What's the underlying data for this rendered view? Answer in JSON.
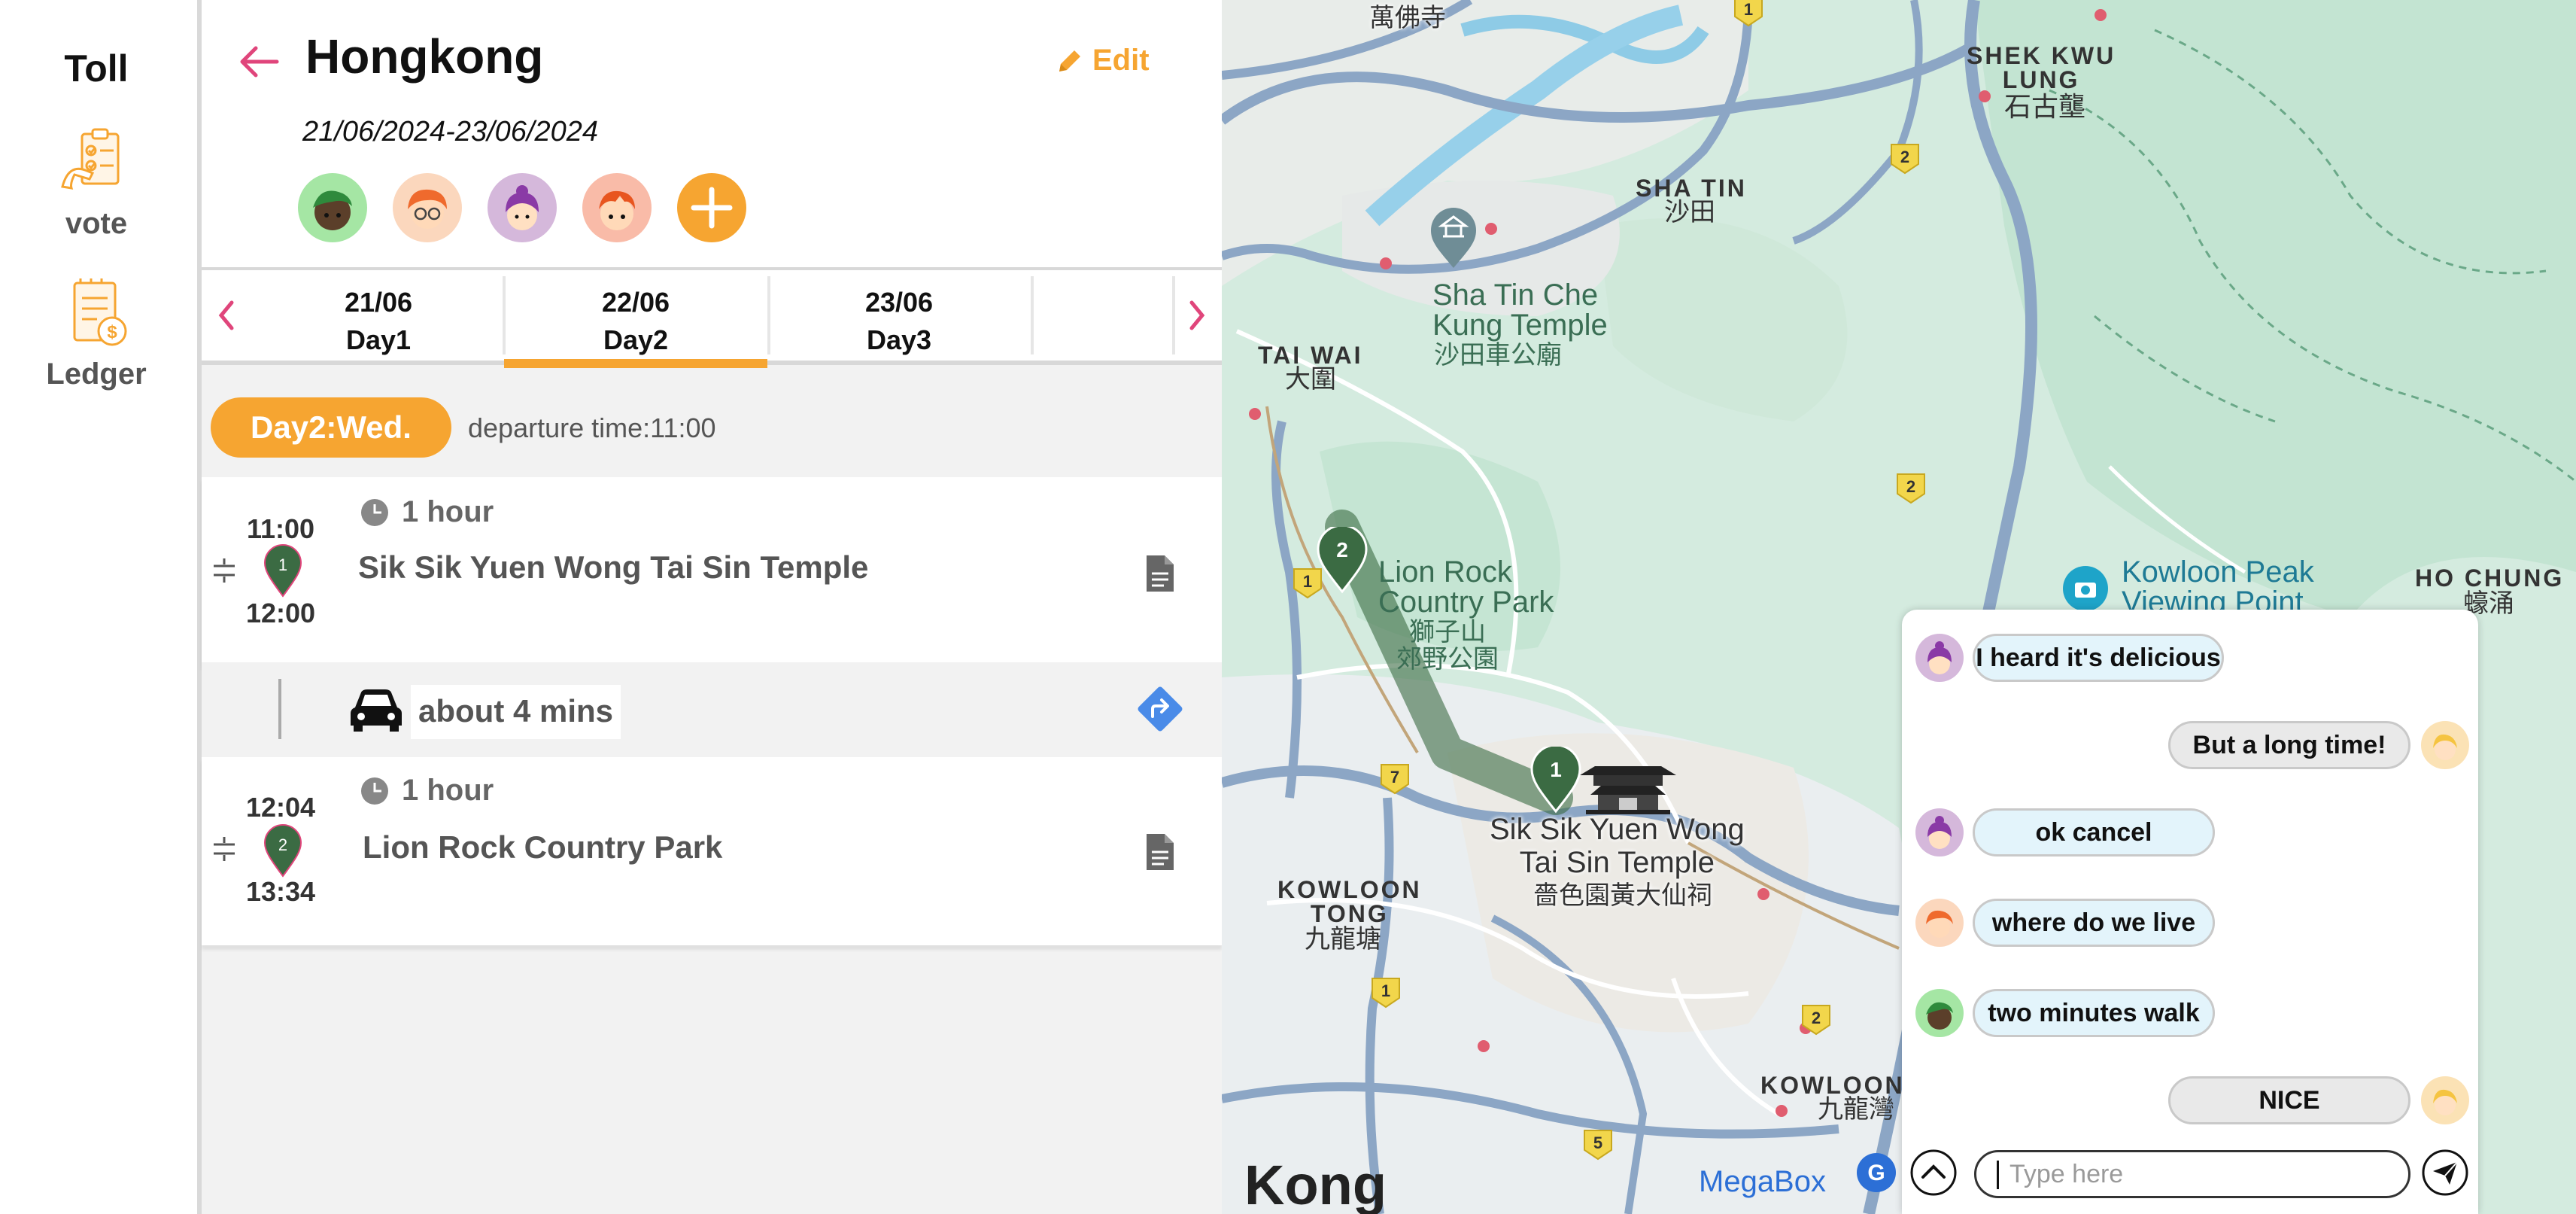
{
  "sidebar": {
    "title": "Toll",
    "items": [
      {
        "label": "vote",
        "icon": "vote-checklist-icon"
      },
      {
        "label": "Ledger",
        "icon": "ledger-money-icon"
      }
    ]
  },
  "trip": {
    "title": "Hongkong",
    "edit_label": "Edit",
    "dates": "21/06/2024-23/06/2024",
    "members": [
      "member-green-avatar",
      "member-orange-glasses-avatar",
      "member-purple-hair-avatar",
      "member-red-hair-avatar"
    ],
    "add_member_label": "+"
  },
  "tabs": [
    {
      "date": "21/06",
      "day": "Day1"
    },
    {
      "date": "22/06",
      "day": "Day2",
      "active": true
    },
    {
      "date": "23/06",
      "day": "Day3"
    }
  ],
  "day_header": {
    "label": "Day2:Wed.",
    "departure": "departure time:11:00"
  },
  "stops": [
    {
      "start": "11:00",
      "end": "12:00",
      "pin": "1",
      "duration": "1 hour",
      "name": "Sik Sik Yuen Wong Tai Sin Temple"
    },
    {
      "start": "12:04",
      "end": "13:34",
      "pin": "2",
      "duration": "1 hour",
      "name": "Lion Rock Country Park"
    }
  ],
  "transit": {
    "label": "about 4 mins",
    "mode": "car-icon"
  },
  "map": {
    "labels": {
      "man_fat_sze": "萬佛寺",
      "shek_kwu_lung_en": "SHEK KWU\nLUNG",
      "shek_kwu_lung_zh": "石古壟",
      "sha_tin_en": "SHA TIN",
      "sha_tin_zh": "沙田",
      "che_kung_en": "Sha Tin Che\nKung Temple",
      "che_kung_zh": "沙田車公廟",
      "tai_wai_en": "TAI WAI",
      "tai_wai_zh": "大圍",
      "lion_rock_en": "Lion Rock\nCountry Park",
      "lion_rock_zh": "獅子山\n郊野公園",
      "kowloon_peak": "Kowloon Peak\nViewing Point",
      "ho_chung_en": "HO CHUNG",
      "ho_chung_zh": "蠔涌",
      "temple_en": "Sik Sik Yuen Wong\nTai Sin Temple",
      "temple_zh": "嗇色園黃大仙祠",
      "kowloon_tong_en": "KOWLOON\nTONG",
      "kowloon_tong_zh": "九龍塘",
      "kowloon_en": "KOWLOON",
      "kowloon_zh": "九龍灣",
      "hong_kong": "Kong",
      "megabox": "MegaBox"
    },
    "route_shields": [
      "1",
      "2",
      "2",
      "1",
      "7",
      "1",
      "2",
      "5"
    ],
    "markers": [
      "1",
      "2"
    ],
    "colors": {
      "accent": "#f6a531",
      "pin": "#3b6b43",
      "route": "#4e7a4c",
      "brand_pink": "#e0457b"
    }
  },
  "chat": {
    "messages": [
      {
        "text": "I heard it's delicious",
        "side": "in",
        "avatar": "purple-hair-avatar"
      },
      {
        "text": "But a long time!",
        "side": "out",
        "avatar": "blonde-avatar"
      },
      {
        "text": "ok cancel",
        "side": "in",
        "avatar": "purple-hair-avatar"
      },
      {
        "text": "where do we live",
        "side": "in",
        "avatar": "orange-hair-avatar"
      },
      {
        "text": "two minutes walk",
        "side": "in",
        "avatar": "green-avatar"
      },
      {
        "text": "NICE",
        "side": "out",
        "avatar": "blonde-avatar"
      }
    ],
    "input_placeholder": "Type here"
  }
}
